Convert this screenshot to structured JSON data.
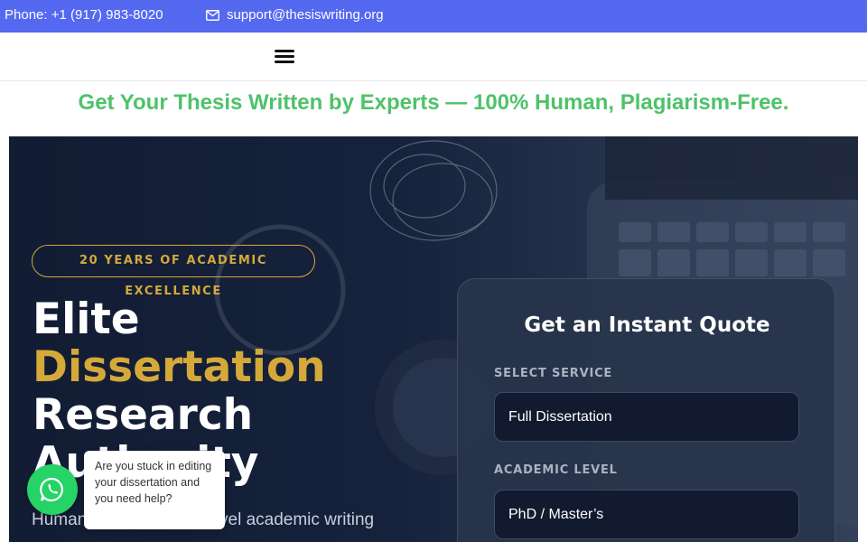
{
  "topbar": {
    "phone": "Phone: +1 (917) 983-8020",
    "email": "support@thesiswriting.org"
  },
  "nav": {
    "menu_icon": "hamburger-menu-icon"
  },
  "tagline": "Get Your Thesis Written by Experts — 100% Human, Plagiarism-Free.",
  "hero": {
    "badge": "20 YEARS OF ACADEMIC EXCELLENCE",
    "headline_line1": "Elite",
    "headline_line2": "Dissertation",
    "headline_line3": "Research",
    "headline_line4": "Authority",
    "subtext": "Human-written, expert-level academic writing"
  },
  "quote": {
    "title": "Get an Instant Quote",
    "service_label": "SELECT SERVICE",
    "service_value": "Full Dissertation",
    "level_label": "ACADEMIC LEVEL",
    "level_value": "PhD / Master’s"
  },
  "whatsapp": {
    "icon": "whatsapp-icon",
    "message": "Are you stuck in editing your dissertation and you need help?"
  },
  "colors": {
    "topbar": "#5468f0",
    "tagline": "#4fc26a",
    "gold": "#d4a93a",
    "whatsapp": "#25d366"
  }
}
